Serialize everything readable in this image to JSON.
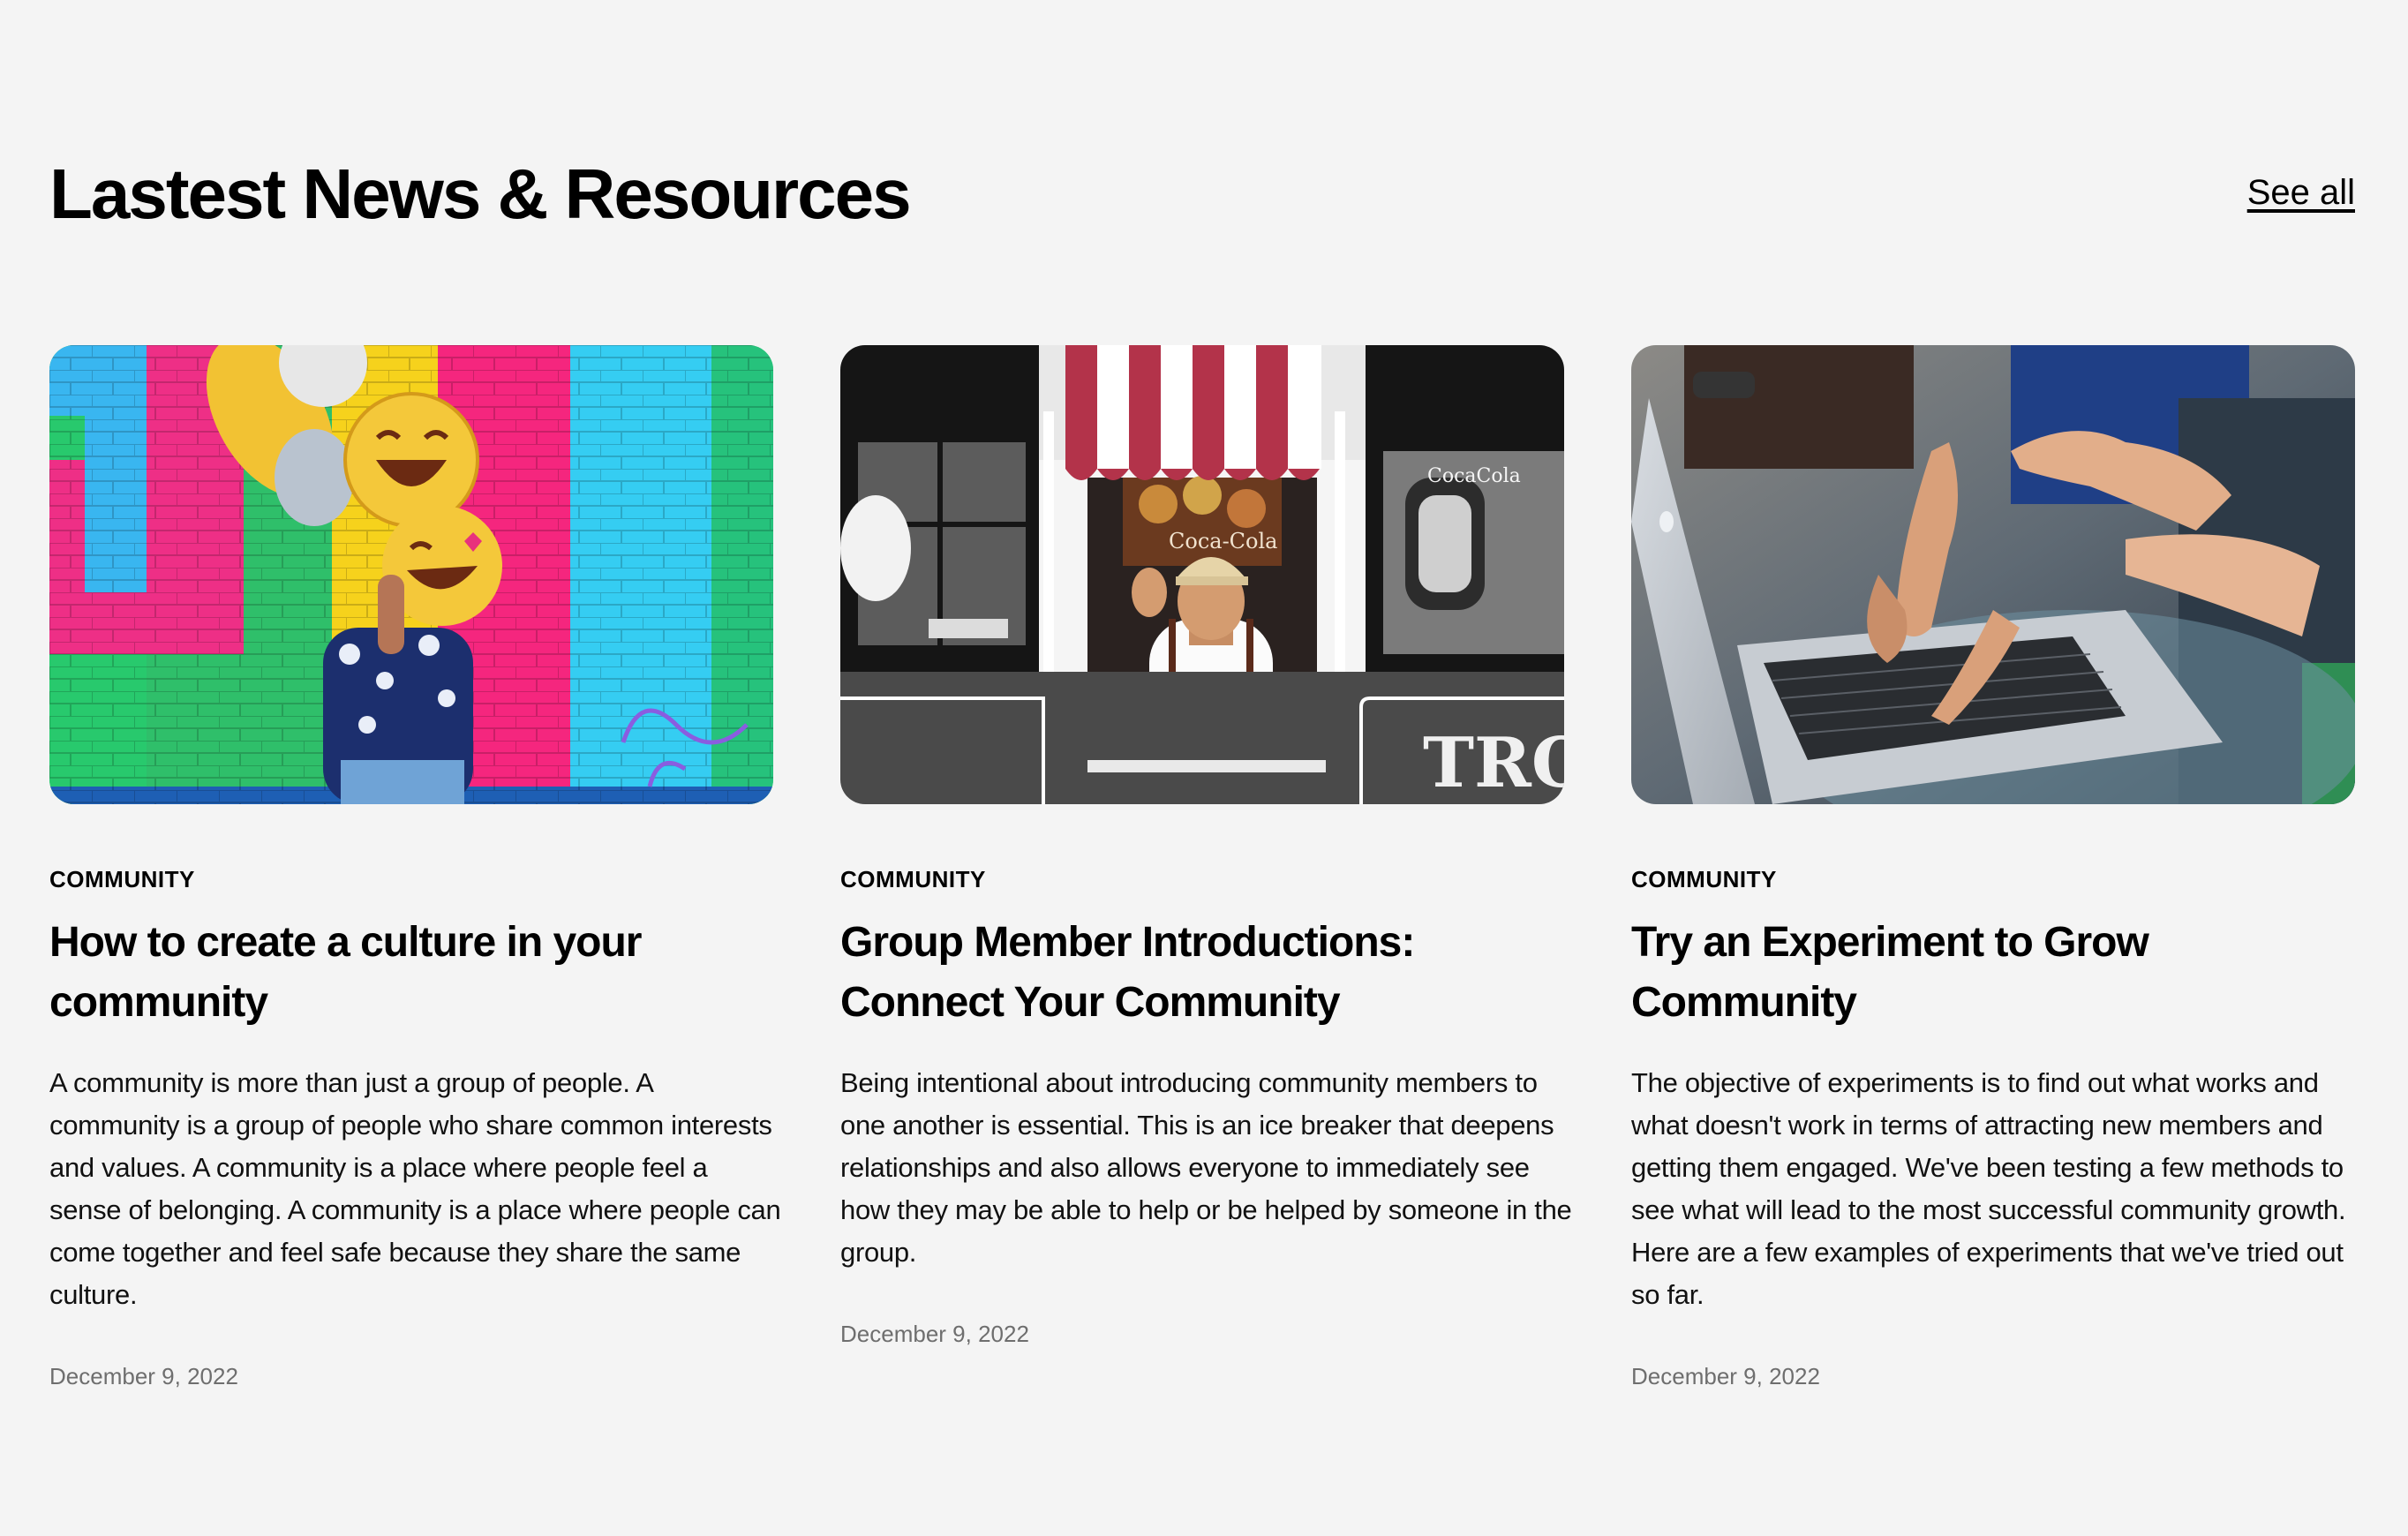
{
  "header": {
    "title": "Lastest News & Resources",
    "see_all_label": "See all"
  },
  "cards": [
    {
      "category": "COMMUNITY",
      "title": "How to create a culture in your community",
      "excerpt": "A community is more than just a group of people. A community is a group of people who share common interests and values. A community is a place where people feel a sense of belonging. A community is a place where people can come together and feel safe because they share the same culture.",
      "date": "December 9, 2022",
      "image": "person-holding-emoji-balloons-in-front-of-colorful-brick-wall"
    },
    {
      "category": "COMMUNITY",
      "title": "Group Member Introductions: Connect Your Community",
      "excerpt": "Being intentional about introducing community members to one another is essential. This is an ice breaker that deepens relationships and also allows everyone to immediately see how they may be able to help or be helped by someone in the group.",
      "date": "December 9, 2022",
      "image": "vendor-waving-from-window-under-striped-awning"
    },
    {
      "category": "COMMUNITY",
      "title": "Try an Experiment to Grow Community",
      "excerpt": "The objective of experiments is to find out what works and what doesn't work in terms of attracting new members and getting them engaged. We've been testing a few methods to see what will lead to the most successful community growth. Here are a few examples of experiments that we've tried out so far.",
      "date": "December 9, 2022",
      "image": "hands-pointing-at-laptop"
    }
  ],
  "colors": {
    "background": "#f4f4f4",
    "text": "#000000",
    "date": "#6e6e6e"
  }
}
